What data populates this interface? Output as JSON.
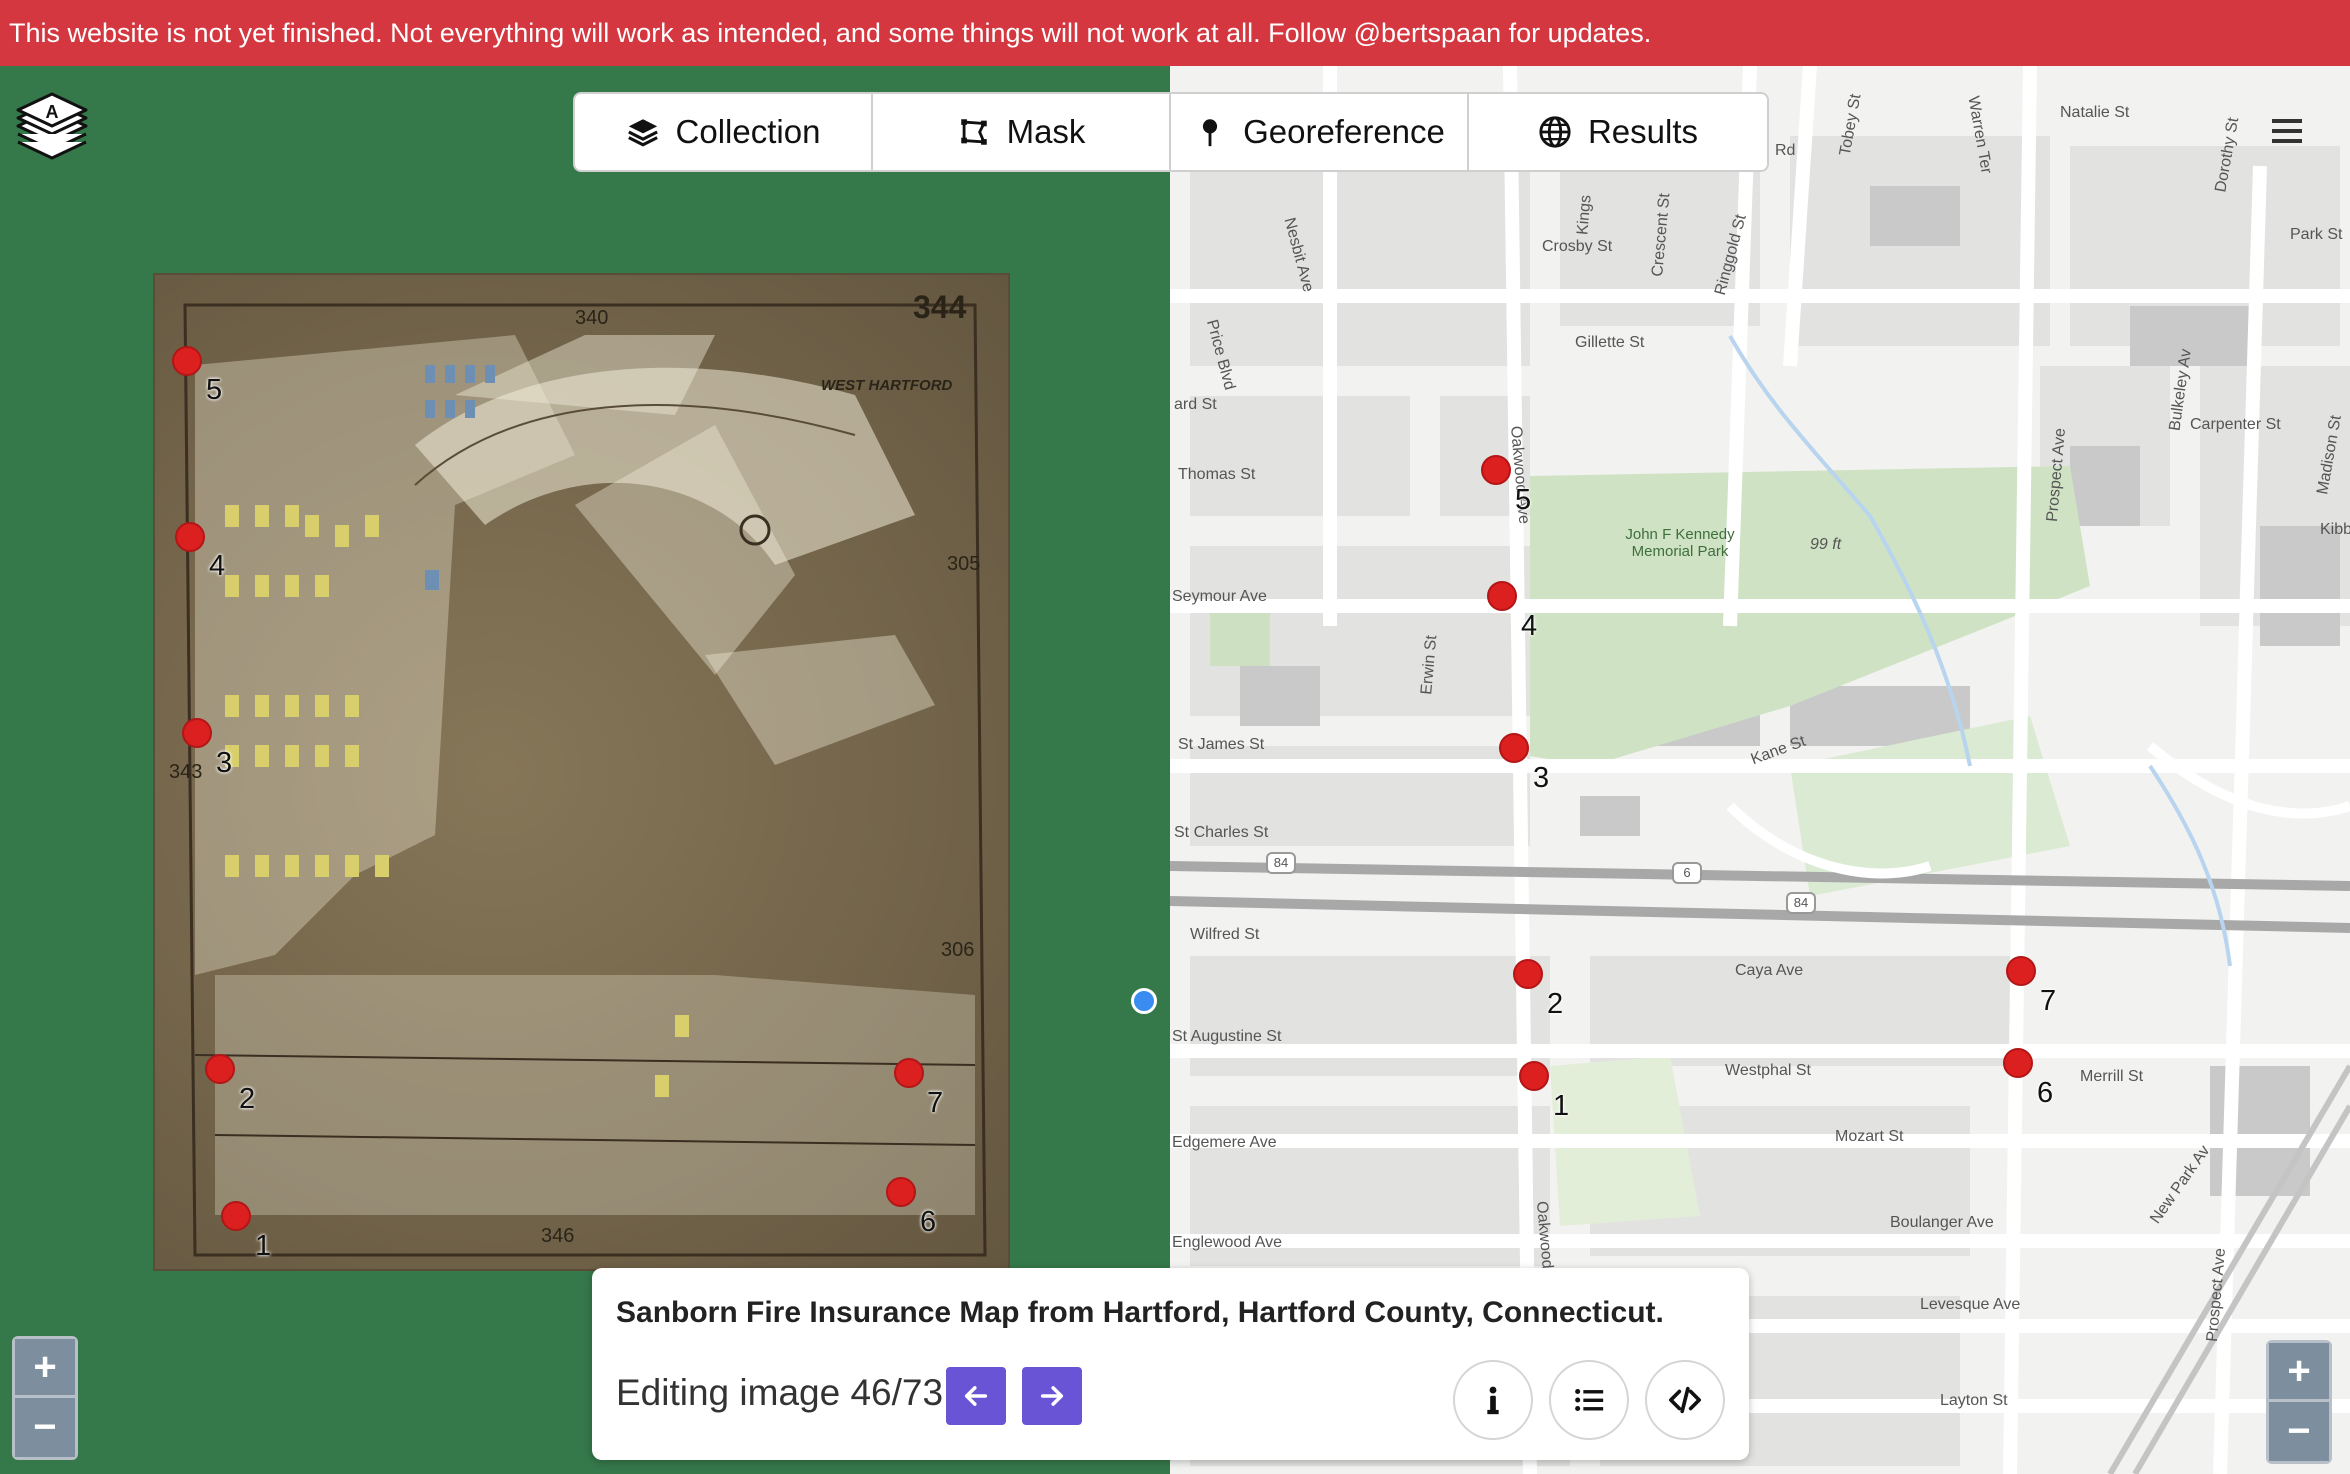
{
  "banner": {
    "text": "This website is not yet finished. Not everything will work as intended, and some things will not work at all. Follow @bertspaan for updates."
  },
  "tabs": [
    {
      "label": "Collection",
      "icon": "layers-icon"
    },
    {
      "label": "Mask",
      "icon": "polygon-icon"
    },
    {
      "label": "Georeference",
      "icon": "pin-icon"
    },
    {
      "label": "Results",
      "icon": "globe-icon"
    }
  ],
  "scan_points": [
    "5",
    "4",
    "3",
    "2",
    "1",
    "7",
    "6"
  ],
  "scan_texts": {
    "sheet_number": "344",
    "adjacent_top": "340",
    "adjacent_right_top": "305",
    "adjacent_right_bottom": "306",
    "adjacent_bottom": "346",
    "adjacent_left": "343",
    "place": "WEST HARTFORD"
  },
  "map_points": [
    "5",
    "4",
    "3",
    "2",
    "1",
    "7",
    "6"
  ],
  "streets": {
    "natalie": "Natalie St",
    "warren": "Warren Ter",
    "tobey": "Tobey St",
    "dorothy": "Dorothy St",
    "park": "Park St",
    "crosby": "Crosby St",
    "kings": "Kings",
    "crescent": "Crescent St",
    "ringgold": "Ringgold St",
    "nesbit": "Nesbit Ave",
    "price": "Price Blvd",
    "gillette": "Gillette St",
    "thomas": "Thomas St",
    "oakwood1": "Oakwood Ave",
    "bulkeley": "Bulkeley Av",
    "carpenter": "Carpenter St",
    "madison": "Madison St",
    "prospect1": "Prospect Ave",
    "seymour": "Seymour Ave",
    "erwin": "Erwin St",
    "park_name": "John F Kennedy Memorial Park",
    "elev": "99 ft",
    "stjames": "St James St",
    "kane": "Kane St",
    "stcharles": "St Charles St",
    "wilfred": "Wilfred St",
    "caya": "Caya Ave",
    "staugustine": "St Augustine St",
    "westphal": "Westphal St",
    "merrill": "Merrill St",
    "mozart": "Mozart St",
    "edgemere": "Edgemere Ave",
    "newpark": "New Park Av",
    "englewood": "Englewood Ave",
    "boulanger": "Boulanger Ave",
    "levesque": "Levesque Ave",
    "layton": "Layton St",
    "prospect2": "Prospect Ave",
    "oakwood2": "Oakwood",
    "rd": "Rd",
    "kibbe": "Kibbe",
    "ard": "ard St",
    "hwy84a": "84",
    "hwy6": "6",
    "hwy84b": "84"
  },
  "zoom": {
    "plus": "+",
    "minus": "−"
  },
  "panel": {
    "title": "Sanborn Fire Insurance Map from Hartford, Hartford County, Connecticut.",
    "editing": "Editing image 46/73"
  },
  "colors": {
    "banner": "#d4373f",
    "accent": "#6a54d6",
    "gcp": "#dc1f1f",
    "left_bg": "#35784a"
  }
}
